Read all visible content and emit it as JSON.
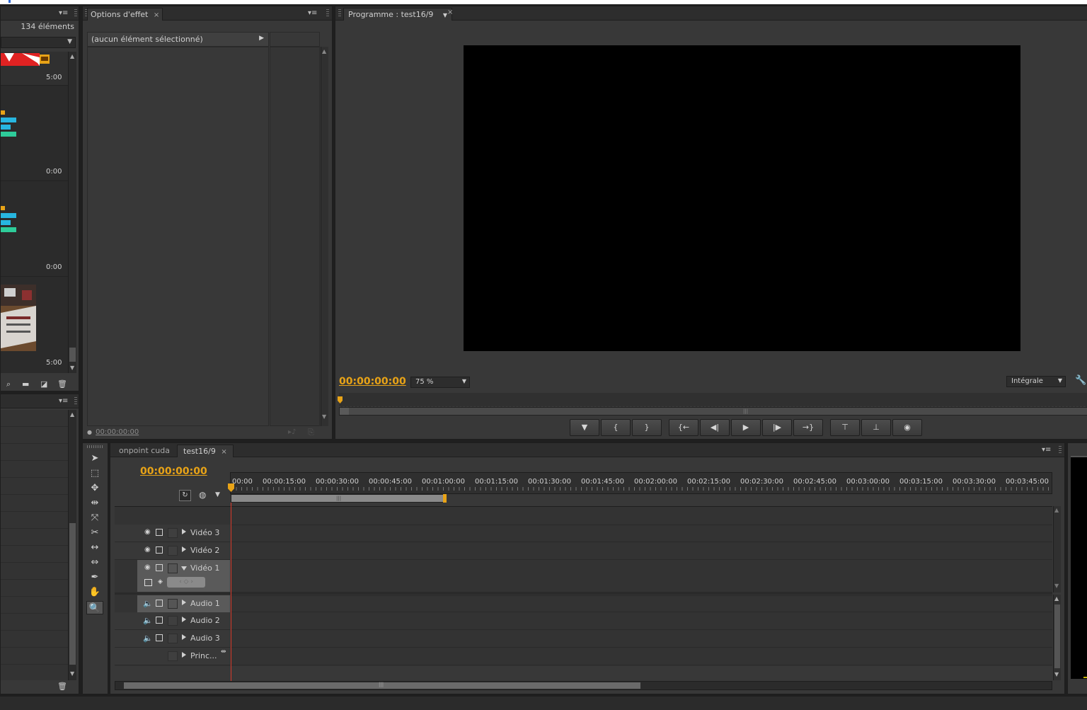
{
  "project_panel": {
    "item_count": "134 éléments",
    "thumbnails": [
      {
        "duration": "5:00"
      },
      {
        "duration": "0:00"
      },
      {
        "duration": "0:00"
      },
      {
        "duration": "5:00"
      }
    ],
    "bottom_icons": [
      "search-icon",
      "folder-icon",
      "new-item-icon",
      "trash-icon"
    ]
  },
  "effect_options": {
    "tab_label": "Options d'effet",
    "no_selection": "(aucun élément sélectionné)",
    "timecode": "00:00:00:00"
  },
  "program_monitor": {
    "tab_label": "Programme : test16/9",
    "timecode": "00:00:00:00",
    "zoom": "75 %",
    "quality": "Intégrale",
    "controls": [
      {
        "name": "add-marker-button",
        "glyph": "▼"
      },
      {
        "name": "mark-in-button",
        "glyph": "{"
      },
      {
        "name": "mark-out-button",
        "glyph": "}"
      },
      {
        "name": "go-to-in-button",
        "glyph": "{←"
      },
      {
        "name": "step-back-button",
        "glyph": "◀|"
      },
      {
        "name": "play-button",
        "glyph": "▶"
      },
      {
        "name": "step-forward-button",
        "glyph": "|▶"
      },
      {
        "name": "go-to-out-button",
        "glyph": "→}"
      },
      {
        "name": "lift-button",
        "glyph": "⊤"
      },
      {
        "name": "extract-button",
        "glyph": "⊥"
      },
      {
        "name": "export-frame-button",
        "glyph": "◉"
      }
    ]
  },
  "timeline": {
    "tabs": [
      "onpoint cuda",
      "test16/9"
    ],
    "timecode": "00:00:00:00",
    "ruler": [
      "00:00",
      "00:00:15:00",
      "00:00:30:00",
      "00:00:45:00",
      "00:01:00:00",
      "00:01:15:00",
      "00:01:30:00",
      "00:01:45:00",
      "00:02:00:00",
      "00:02:15:00",
      "00:02:30:00",
      "00:02:45:00",
      "00:03:00:00",
      "00:03:15:00",
      "00:03:30:00",
      "00:03:45:00"
    ],
    "video_tracks": [
      "Vidéo 3",
      "Vidéo 2",
      "Vidéo 1"
    ],
    "audio_tracks": [
      "Audio 1",
      "Audio 2",
      "Audio 3"
    ],
    "master_track": "Princ...",
    "tools": [
      "selection-tool-icon",
      "track-select-tool-icon",
      "ripple-edit-tool-icon",
      "rolling-edit-tool-icon",
      "rate-stretch-tool-icon",
      "razor-tool-icon",
      "slip-tool-icon",
      "slide-tool-icon",
      "pen-tool-icon",
      "hand-tool-icon",
      "zoom-tool-icon"
    ]
  },
  "colors": {
    "timecode": "#e8a317",
    "panel": "#383838",
    "playhead": "#d93a2b",
    "cyan_clip": "#27b6e0",
    "green_clip": "#2ecc9a"
  }
}
